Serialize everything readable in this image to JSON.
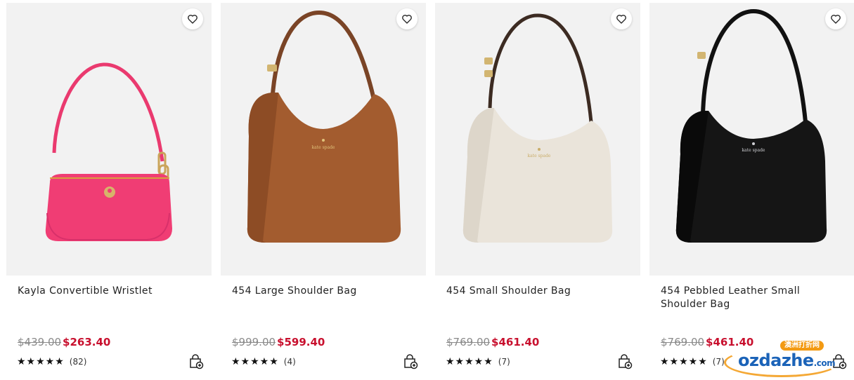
{
  "products": [
    {
      "name": "Kayla Convertible Wristlet",
      "original_price": "$439.00",
      "sale_price": "$263.40",
      "stars": "★★★★★",
      "review_count": "(82)",
      "color": "#f03d74",
      "icon": "wristlet-image"
    },
    {
      "name": "454 Large Shoulder Bag",
      "original_price": "$999.00",
      "sale_price": "$599.40",
      "stars": "★★★★★",
      "review_count": "(4)",
      "color": "#a35c2f",
      "icon": "shoulder-bag-image"
    },
    {
      "name": "454 Small Shoulder Bag",
      "original_price": "$769.00",
      "sale_price": "$461.40",
      "stars": "★★★★★",
      "review_count": "(7)",
      "color": "#eae4da",
      "icon": "shoulder-bag-image"
    },
    {
      "name": "454 Pebbled Leather Small Shoulder Bag",
      "original_price": "$769.00",
      "sale_price": "$461.40",
      "stars": "★★★★★",
      "review_count": "(7)",
      "color": "#151515",
      "icon": "shoulder-bag-image"
    }
  ],
  "icons": {
    "wishlist": "heart-icon",
    "add_to_bag": "shopping-bag-plus-icon"
  },
  "accent_sale_color": "#c8102e",
  "watermark": {
    "top": "澳洲打折网",
    "main": "ozdazhe",
    "suffix": ".com"
  }
}
